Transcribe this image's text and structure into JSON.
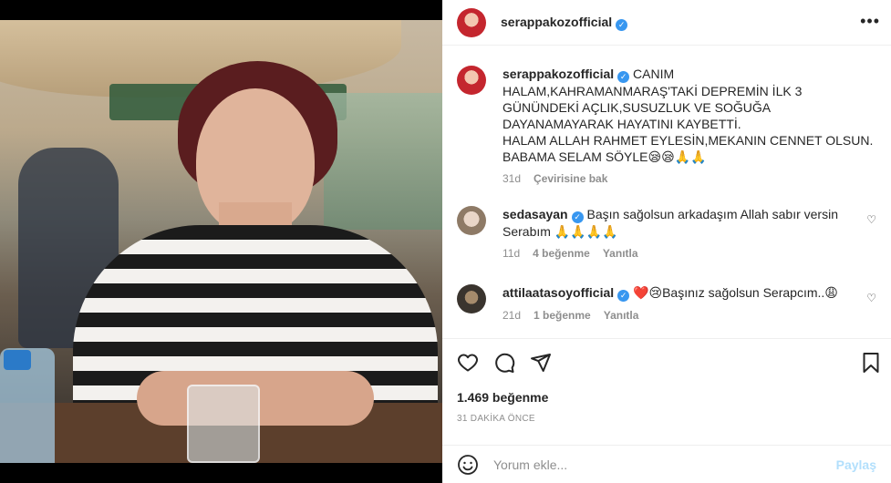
{
  "post": {
    "author": "serappakozofficial",
    "more_icon": "more-horizontal-icon",
    "caption_lines": [
      "CANIM",
      "HALAM,KAHRAMANMARAŞ'TAKİ DEPREMİN İLK 3",
      "GÜNÜNDEKİ AÇLIK,SUSUZLUK VE SOĞUĞA",
      "DAYANAMAYARAK HAYATINI KAYBETTİ.",
      "HALAM ALLAH RAHMET EYLESİN,MEKANIN CENNET OLSUN.",
      "BABAMA SELAM SÖYLE😪😪🙏🙏"
    ],
    "caption_time": "31d",
    "translate": "Çevirisine bak"
  },
  "comments": [
    {
      "user": "sedasayan",
      "text": "Başın sağolsun arkadaşım Allah sabır versin Serabım 🙏🙏🙏🙏",
      "time": "11d",
      "likes": "4 beğenme",
      "reply": "Yanıtla"
    },
    {
      "user": "attilaatasoyofficial",
      "text": "❤️😢Başınız sağolsun Serapcım..😩",
      "time": "21d",
      "likes": "1 beğenme",
      "reply": "Yanıtla"
    }
  ],
  "actions": {
    "likes_count": "1.469 beğenme",
    "time_ago": "31 DAKİKA ÖNCE"
  },
  "composer": {
    "placeholder": "Yorum ekle...",
    "post_label": "Paylaş"
  },
  "colors": {
    "verified": "#3897f0",
    "muted": "#8e8e8e",
    "post_disabled": "#b2dffc"
  }
}
